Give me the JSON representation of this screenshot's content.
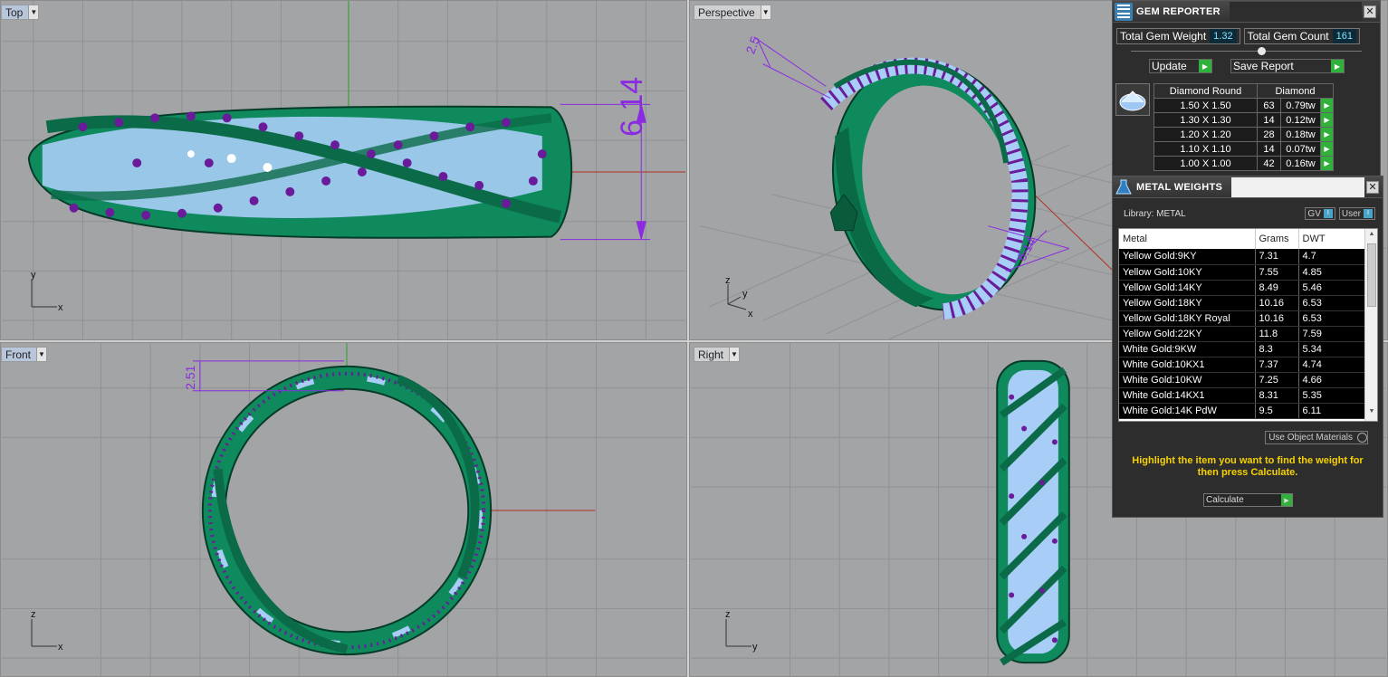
{
  "viewports": {
    "top": {
      "label": "Top",
      "dimension": "6.14",
      "axes": [
        "y",
        "x"
      ]
    },
    "perspective": {
      "label": "Perspective",
      "dim_a": "2.5",
      "dim_b": "6.14",
      "axes": [
        "z",
        "y",
        "x"
      ]
    },
    "front": {
      "label": "Front",
      "dimension": "2.51",
      "axes": [
        "z",
        "x"
      ]
    },
    "right": {
      "label": "Right",
      "axes": [
        "z",
        "y"
      ]
    }
  },
  "gem_reporter": {
    "title": "GEM REPORTER",
    "total_gem_weight_label": "Total Gem Weight",
    "total_gem_weight": "1.32",
    "total_gem_count_label": "Total Gem Count",
    "total_gem_count": "161",
    "update_label": "Update",
    "save_report_label": "Save Report",
    "table_headers": [
      "Diamond Round",
      "Diamond"
    ],
    "rows": [
      {
        "size": "1.50 X 1.50",
        "count": "63",
        "weight": "0.79tw"
      },
      {
        "size": "1.30 X 1.30",
        "count": "14",
        "weight": "0.12tw"
      },
      {
        "size": "1.20 X 1.20",
        "count": "28",
        "weight": "0.18tw"
      },
      {
        "size": "1.10 X 1.10",
        "count": "14",
        "weight": "0.07tw"
      },
      {
        "size": "1.00 X 1.00",
        "count": "42",
        "weight": "0.16tw"
      }
    ]
  },
  "metal_weights": {
    "title": "METAL WEIGHTS",
    "library_label": "Library: METAL",
    "gv_label": "GV",
    "user_label": "User",
    "headers": [
      "Metal",
      "Grams",
      "DWT"
    ],
    "rows": [
      {
        "metal": "Yellow Gold:9KY",
        "grams": "7.31",
        "dwt": "4.7"
      },
      {
        "metal": "Yellow Gold:10KY",
        "grams": "7.55",
        "dwt": "4.85"
      },
      {
        "metal": "Yellow Gold:14KY",
        "grams": "8.49",
        "dwt": "5.46"
      },
      {
        "metal": "Yellow Gold:18KY",
        "grams": "10.16",
        "dwt": "6.53"
      },
      {
        "metal": "Yellow Gold:18KY Royal",
        "grams": "10.16",
        "dwt": "6.53"
      },
      {
        "metal": "Yellow Gold:22KY",
        "grams": "11.8",
        "dwt": "7.59"
      },
      {
        "metal": "White Gold:9KW",
        "grams": "8.3",
        "dwt": "5.34"
      },
      {
        "metal": "White Gold:10KX1",
        "grams": "7.37",
        "dwt": "4.74"
      },
      {
        "metal": "White Gold:10KW",
        "grams": "7.25",
        "dwt": "4.66"
      },
      {
        "metal": "White Gold:14KX1",
        "grams": "8.31",
        "dwt": "5.35"
      },
      {
        "metal": "White Gold:14K PdW",
        "grams": "9.5",
        "dwt": "6.11"
      }
    ],
    "use_object_materials_label": "Use Object Materials",
    "hint": "Highlight the item you want to find the weight for then press Calculate.",
    "calculate_label": "Calculate"
  },
  "colors": {
    "ring_green": "#0f8a5f",
    "gem_blue": "#9ec7f5",
    "accent_purple": "#7b1fa2",
    "dimension_purple": "#8a2be2",
    "viewport_bg": "#a2a4a6",
    "hint_yellow": "#f6d200",
    "go_green": "#2fb13b"
  }
}
